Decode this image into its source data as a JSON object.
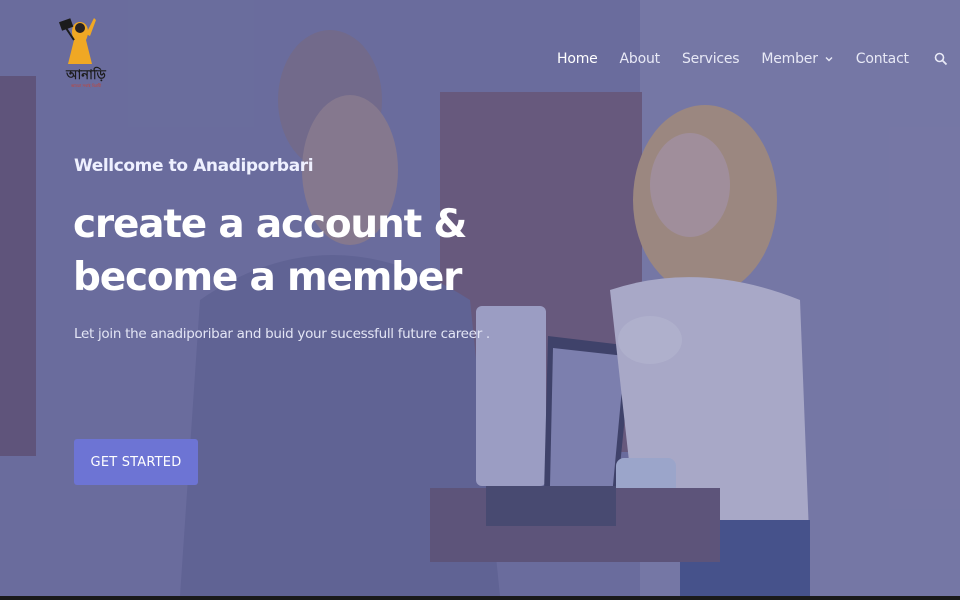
{
  "brand": {
    "logo_text": "আনাড়ি",
    "logo_subtext": "আমরা সবাই বিপ্লবী"
  },
  "nav": {
    "items": [
      {
        "label": "Home",
        "active": true
      },
      {
        "label": "About"
      },
      {
        "label": "Services"
      },
      {
        "label": "Member",
        "has_dropdown": true
      },
      {
        "label": "Contact"
      }
    ],
    "search_icon": "search-icon"
  },
  "hero": {
    "welcome": "Wellcome to Anadiporbari",
    "headline_line1": "create a account &",
    "headline_line2": "become a member",
    "subtext": "Let join the anadiporibar and buid your sucessfull future career .",
    "cta_label": "GET STARTED"
  },
  "colors": {
    "overlay": "#5b5f96",
    "button": "#6d74d4",
    "logo_accent": "#f0a824"
  }
}
